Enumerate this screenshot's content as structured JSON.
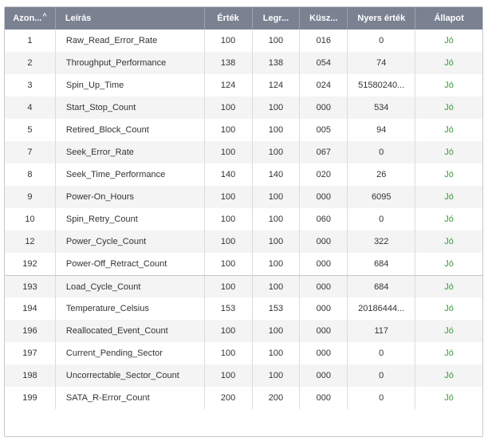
{
  "table": {
    "headers": {
      "id": "Azon...",
      "description": "Leírás",
      "value": "Érték",
      "worst": "Legr...",
      "threshold": "Küsz...",
      "raw": "Nyers érték",
      "status": "Állapot"
    },
    "sort_icon": "sort-ascending-caret-icon",
    "status_color": "#3b9c3b",
    "header_bg": "#7a8292",
    "rows": [
      {
        "id": "1",
        "description": "Raw_Read_Error_Rate",
        "value": "100",
        "worst": "100",
        "threshold": "016",
        "raw": "0",
        "status": "Jó"
      },
      {
        "id": "2",
        "description": "Throughput_Performance",
        "value": "138",
        "worst": "138",
        "threshold": "054",
        "raw": "74",
        "status": "Jó"
      },
      {
        "id": "3",
        "description": "Spin_Up_Time",
        "value": "124",
        "worst": "124",
        "threshold": "024",
        "raw": "51580240...",
        "status": "Jó"
      },
      {
        "id": "4",
        "description": "Start_Stop_Count",
        "value": "100",
        "worst": "100",
        "threshold": "000",
        "raw": "534",
        "status": "Jó"
      },
      {
        "id": "5",
        "description": "Retired_Block_Count",
        "value": "100",
        "worst": "100",
        "threshold": "005",
        "raw": "94",
        "status": "Jó"
      },
      {
        "id": "7",
        "description": "Seek_Error_Rate",
        "value": "100",
        "worst": "100",
        "threshold": "067",
        "raw": "0",
        "status": "Jó"
      },
      {
        "id": "8",
        "description": "Seek_Time_Performance",
        "value": "140",
        "worst": "140",
        "threshold": "020",
        "raw": "26",
        "status": "Jó"
      },
      {
        "id": "9",
        "description": "Power-On_Hours",
        "value": "100",
        "worst": "100",
        "threshold": "000",
        "raw": "6095",
        "status": "Jó"
      },
      {
        "id": "10",
        "description": "Spin_Retry_Count",
        "value": "100",
        "worst": "100",
        "threshold": "060",
        "raw": "0",
        "status": "Jó"
      },
      {
        "id": "12",
        "description": "Power_Cycle_Count",
        "value": "100",
        "worst": "100",
        "threshold": "000",
        "raw": "322",
        "status": "Jó"
      },
      {
        "id": "192",
        "description": "Power-Off_Retract_Count",
        "value": "100",
        "worst": "100",
        "threshold": "000",
        "raw": "684",
        "status": "Jó"
      },
      {
        "id": "193",
        "description": "Load_Cycle_Count",
        "value": "100",
        "worst": "100",
        "threshold": "000",
        "raw": "684",
        "status": "Jó"
      },
      {
        "id": "194",
        "description": "Temperature_Celsius",
        "value": "153",
        "worst": "153",
        "threshold": "000",
        "raw": "20186444...",
        "status": "Jó"
      },
      {
        "id": "196",
        "description": "Reallocated_Event_Count",
        "value": "100",
        "worst": "100",
        "threshold": "000",
        "raw": "117",
        "status": "Jó"
      },
      {
        "id": "197",
        "description": "Current_Pending_Sector",
        "value": "100",
        "worst": "100",
        "threshold": "000",
        "raw": "0",
        "status": "Jó"
      },
      {
        "id": "198",
        "description": "Uncorrectable_Sector_Count",
        "value": "100",
        "worst": "100",
        "threshold": "000",
        "raw": "0",
        "status": "Jó"
      },
      {
        "id": "199",
        "description": "SATA_R-Error_Count",
        "value": "200",
        "worst": "200",
        "threshold": "000",
        "raw": "0",
        "status": "Jó"
      }
    ]
  }
}
